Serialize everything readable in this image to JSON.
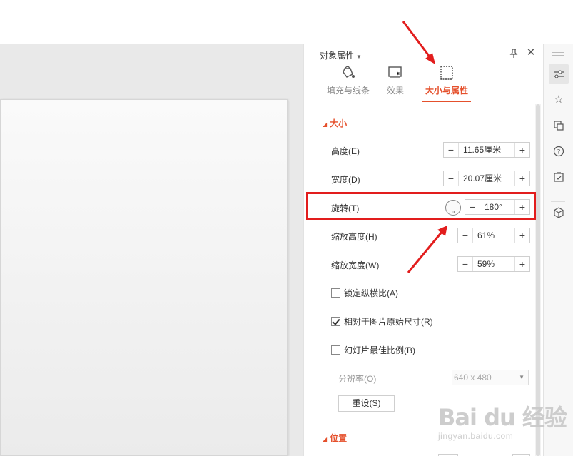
{
  "panel": {
    "title": "对象属性",
    "tabs": [
      {
        "label": "填充与线条",
        "icon": "fill-bucket-icon"
      },
      {
        "label": "效果",
        "icon": "effects-icon"
      },
      {
        "label": "大小与属性",
        "icon": "size-properties-icon",
        "active": true
      }
    ]
  },
  "size_section": {
    "heading": "大小",
    "height": {
      "label": "高度(E)",
      "value": "11.65厘米"
    },
    "width": {
      "label": "宽度(D)",
      "value": "20.07厘米"
    },
    "rotation": {
      "label": "旋转(T)",
      "value": "180°"
    },
    "scale_height": {
      "label": "缩放高度(H)",
      "value": "61%"
    },
    "scale_width": {
      "label": "缩放宽度(W)",
      "value": "59%"
    },
    "lock_aspect": {
      "label": "锁定纵横比(A)",
      "checked": false
    },
    "relative_original": {
      "label": "相对于图片原始尺寸(R)",
      "checked": true
    },
    "slide_best_ratio": {
      "label": "幻灯片最佳比例(B)",
      "checked": false
    },
    "resolution": {
      "label": "分辨率(O)",
      "value": "640 x 480"
    },
    "reset_label": "重设(S)"
  },
  "position_section": {
    "heading": "位置"
  },
  "stepper": {
    "minus": "−",
    "plus": "+"
  },
  "watermark": {
    "logo": "Bai du 经验",
    "url": "jingyan.baidu.com"
  },
  "colors": {
    "accent": "#e5502c",
    "annotation": "#e21d1d"
  }
}
